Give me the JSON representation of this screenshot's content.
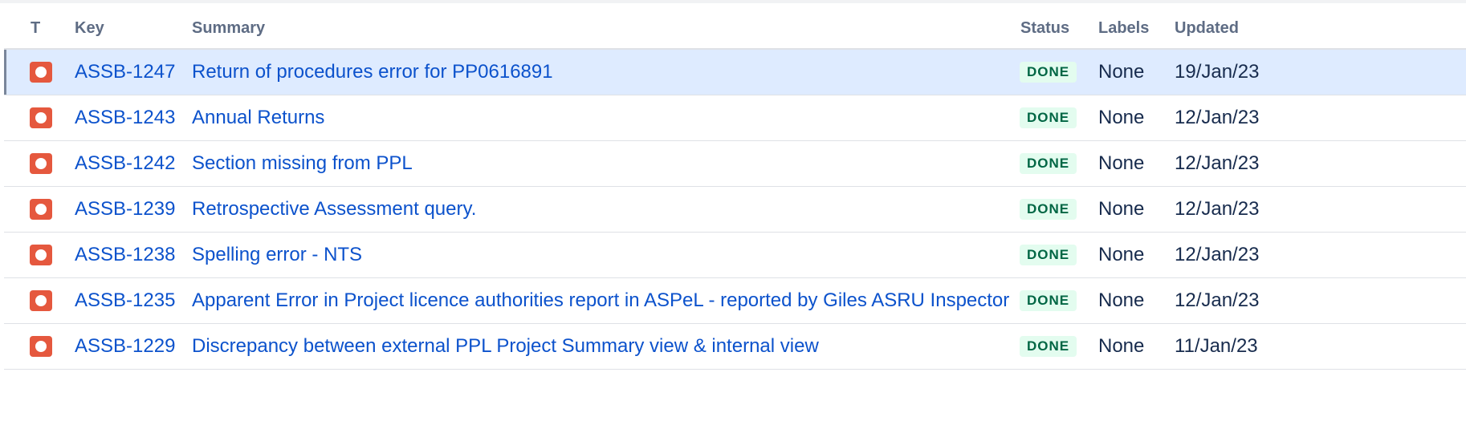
{
  "columns": {
    "type": "T",
    "key": "Key",
    "summary": "Summary",
    "status": "Status",
    "labels": "Labels",
    "updated": "Updated"
  },
  "colors": {
    "issue_icon": "#e5583e",
    "link": "#0c52cc",
    "done_badge_bg": "#e3fcef",
    "done_badge_text": "#006644",
    "selected_row_bg": "#deebff"
  },
  "rows": [
    {
      "icon": "bug-icon",
      "key": "ASSB-1247",
      "summary": "Return of procedures error for PP0616891",
      "status": "DONE",
      "labels": "None",
      "updated": "19/Jan/23",
      "selected": true
    },
    {
      "icon": "bug-icon",
      "key": "ASSB-1243",
      "summary": "Annual Returns",
      "status": "DONE",
      "labels": "None",
      "updated": "12/Jan/23"
    },
    {
      "icon": "bug-icon",
      "key": "ASSB-1242",
      "summary": "Section missing from PPL",
      "status": "DONE",
      "labels": "None",
      "updated": "12/Jan/23"
    },
    {
      "icon": "bug-icon",
      "key": "ASSB-1239",
      "summary": "Retrospective Assessment query.",
      "status": "DONE",
      "labels": "None",
      "updated": "12/Jan/23"
    },
    {
      "icon": "bug-icon",
      "key": "ASSB-1238",
      "summary": "Spelling error - NTS",
      "status": "DONE",
      "labels": "None",
      "updated": "12/Jan/23"
    },
    {
      "icon": "bug-icon",
      "key": "ASSB-1235",
      "summary": "Apparent Error in Project licence authorities report in ASPeL - reported by Giles ASRU Inspector",
      "status": "DONE",
      "labels": "None",
      "updated": "12/Jan/23"
    },
    {
      "icon": "bug-icon",
      "key": "ASSB-1229",
      "summary": "Discrepancy between external PPL Project Summary view & internal view",
      "status": "DONE",
      "labels": "None",
      "updated": "11/Jan/23"
    }
  ]
}
